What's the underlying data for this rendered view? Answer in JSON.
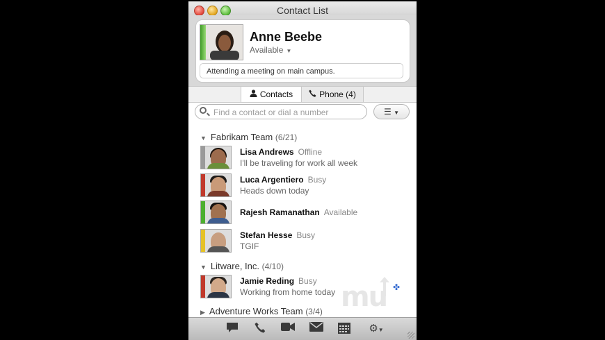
{
  "window": {
    "title": "Contact List"
  },
  "profile": {
    "name": "Anne Beebe",
    "status": "Available",
    "note": "Attending a meeting on main campus."
  },
  "tabs": [
    {
      "label": "Contacts",
      "icon": "person-icon",
      "selected": true
    },
    {
      "label": "Phone (4)",
      "icon": "phone-icon",
      "selected": false
    }
  ],
  "search": {
    "placeholder": "Find a contact or dial a number"
  },
  "groups": [
    {
      "name": "Fabrikam Team",
      "count": "(6/21)",
      "expanded": true
    },
    {
      "name": "Litware, Inc.",
      "count": "(4/10)",
      "expanded": true
    },
    {
      "name": "Adventure Works Team",
      "count": "(3/4)",
      "expanded": false
    }
  ],
  "contacts": [
    {
      "name": "Lisa Andrews",
      "status": "Offline",
      "note": "I'll be traveling for work all week",
      "presence_color": "#9a9a9a"
    },
    {
      "name": "Luca Argentiero",
      "status": "Busy",
      "note": "Heads down today",
      "presence_color": "#c0392b"
    },
    {
      "name": "Rajesh Ramanathan",
      "status": "Available",
      "note": "",
      "presence_color": "#4caf2f"
    },
    {
      "name": "Stefan Hesse",
      "status": "Busy",
      "note": "TGIF",
      "presence_color": "#e5c227"
    },
    {
      "name": "Jamie Reding",
      "status": "Busy",
      "note": "Working from home today",
      "presence_color": "#c0392b"
    }
  ],
  "toolbar": [
    "chat-icon",
    "phone-icon",
    "video-icon",
    "mail-icon",
    "calendar-icon",
    "gear-icon"
  ]
}
